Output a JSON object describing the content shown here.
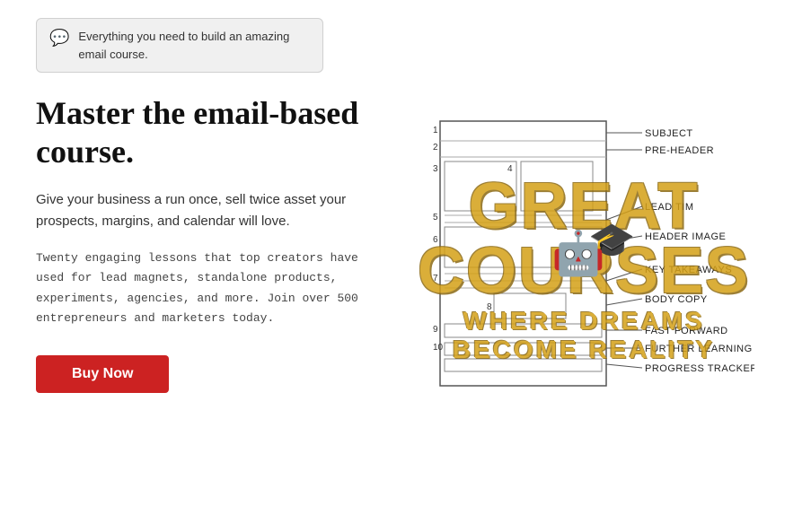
{
  "tooltip": {
    "icon": "💬",
    "text": "Everything you need to build an amazing email course."
  },
  "heading": {
    "main": "Master the email-based course.",
    "description": "Give your business a run once, sell twice asset your prospects, margins, and calendar will love.",
    "secondary": "Twenty engaging lessons that top creators have used for lead magnets, standalone products, experiments, agencies, and more. Join over 500 entrepreneurs and marketers today."
  },
  "button": {
    "label": "Buy Now"
  },
  "diagram": {
    "items": [
      {
        "number": "1",
        "label": "SUBJECT"
      },
      {
        "number": "2",
        "label": "PRE-HEADER"
      },
      {
        "number": "3",
        "label": ""
      },
      {
        "number": "4",
        "label": ""
      },
      {
        "number": "5",
        "label": "LEAD TIM"
      },
      {
        "number": "6",
        "label": "HEADER IMAGE"
      },
      {
        "number": "7",
        "label": "KEY TAKEAWAYS"
      },
      {
        "number": "8",
        "label": "BODY COPY"
      },
      {
        "number": "9",
        "label": "FAST FORWARD"
      },
      {
        "number": "10",
        "label": "FURTHER LEARNING"
      },
      {
        "number": "",
        "label": "PROGRESS TRACKER"
      }
    ]
  },
  "watermark": {
    "line1": "GREAT COURSES",
    "line2": "WHERE DREAMS BECOME REALITY"
  }
}
